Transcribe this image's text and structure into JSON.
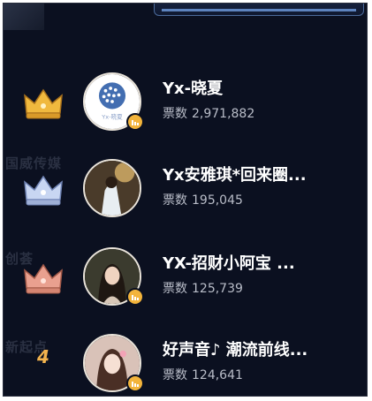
{
  "leaderboard": {
    "vote_label": "票数",
    "items": [
      {
        "rank": "1",
        "rank_icon": "gold-crown-icon",
        "name": "Yx-晓夏",
        "votes": "2,971,882",
        "avatar": "logo-avatar",
        "avatar_logo_text": "Yx-晓夏"
      },
      {
        "rank": "2",
        "rank_icon": "silver-crown-icon",
        "name": "Yx安雅琪*回来圈...",
        "votes": "195,045",
        "avatar": "photo-avatar"
      },
      {
        "rank": "3",
        "rank_icon": "bronze-crown-icon",
        "name": "YX-招财小阿宝 ...",
        "votes": "125,739",
        "avatar": "photo-avatar"
      },
      {
        "rank": "4",
        "rank_icon": "",
        "name": "好声音♪ 潮流前线...",
        "votes": "124,641",
        "avatar": "photo-avatar"
      }
    ]
  },
  "background_text": [
    "国威传媒",
    "创荟",
    "新起点"
  ],
  "colors": {
    "panel": "#0b1020",
    "gold": "#f3b43b",
    "rank4": "#f4b44e",
    "text": "#ffffff",
    "muted": "#b9bdc8"
  }
}
